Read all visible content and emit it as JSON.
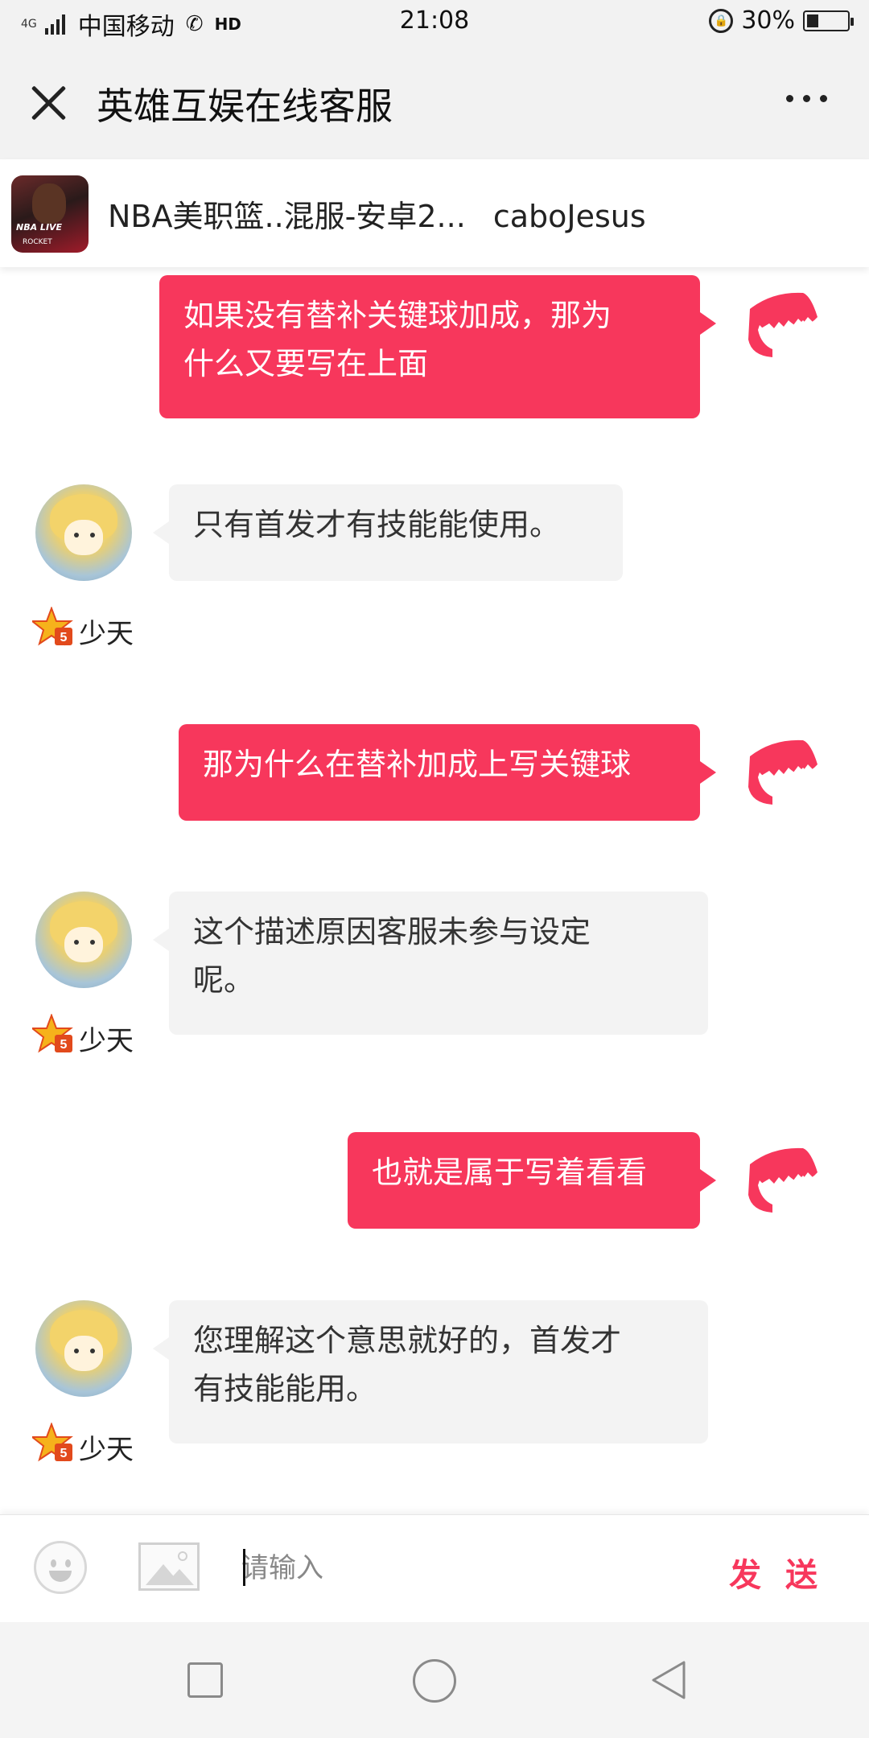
{
  "status_bar": {
    "network": "4G",
    "carrier": "中国移动",
    "hd": "HD",
    "time": "21:08",
    "battery": "30%",
    "battery_level": 0.3
  },
  "header": {
    "title": "英雄互娱在线客服",
    "close_icon": "close-icon",
    "more_icon": "more-icon"
  },
  "game": {
    "name": "NBA美职篮..混服-安卓2...",
    "user": "caboJesus",
    "icon_text": "NBA LIVE",
    "icon_sub": "ROCKET"
  },
  "messages": [
    {
      "from": "me",
      "lines": [
        "如果没有替补关键球加成，那为",
        "什么又要写在上面"
      ]
    },
    {
      "from": "cs",
      "lines": [
        "只有首发才有技能能使用。"
      ],
      "name": "少天"
    },
    {
      "from": "me",
      "lines": [
        "那为什么在替补加成上写关键球"
      ]
    },
    {
      "from": "cs",
      "lines": [
        "这个描述原因客服未参与设定",
        "呢。"
      ],
      "name": "少天"
    },
    {
      "from": "me",
      "lines": [
        "也就是属于写着看看"
      ]
    },
    {
      "from": "cs",
      "lines": [
        "您理解这个意思就好的，首发才",
        "有技能能用。"
      ],
      "name": "少天"
    }
  ],
  "input": {
    "placeholder": "请输入",
    "send_label": "发 送"
  },
  "colors": {
    "accent": "#f7375c",
    "cs_bubble": "#f3f3f3",
    "background": "#ffffff"
  }
}
